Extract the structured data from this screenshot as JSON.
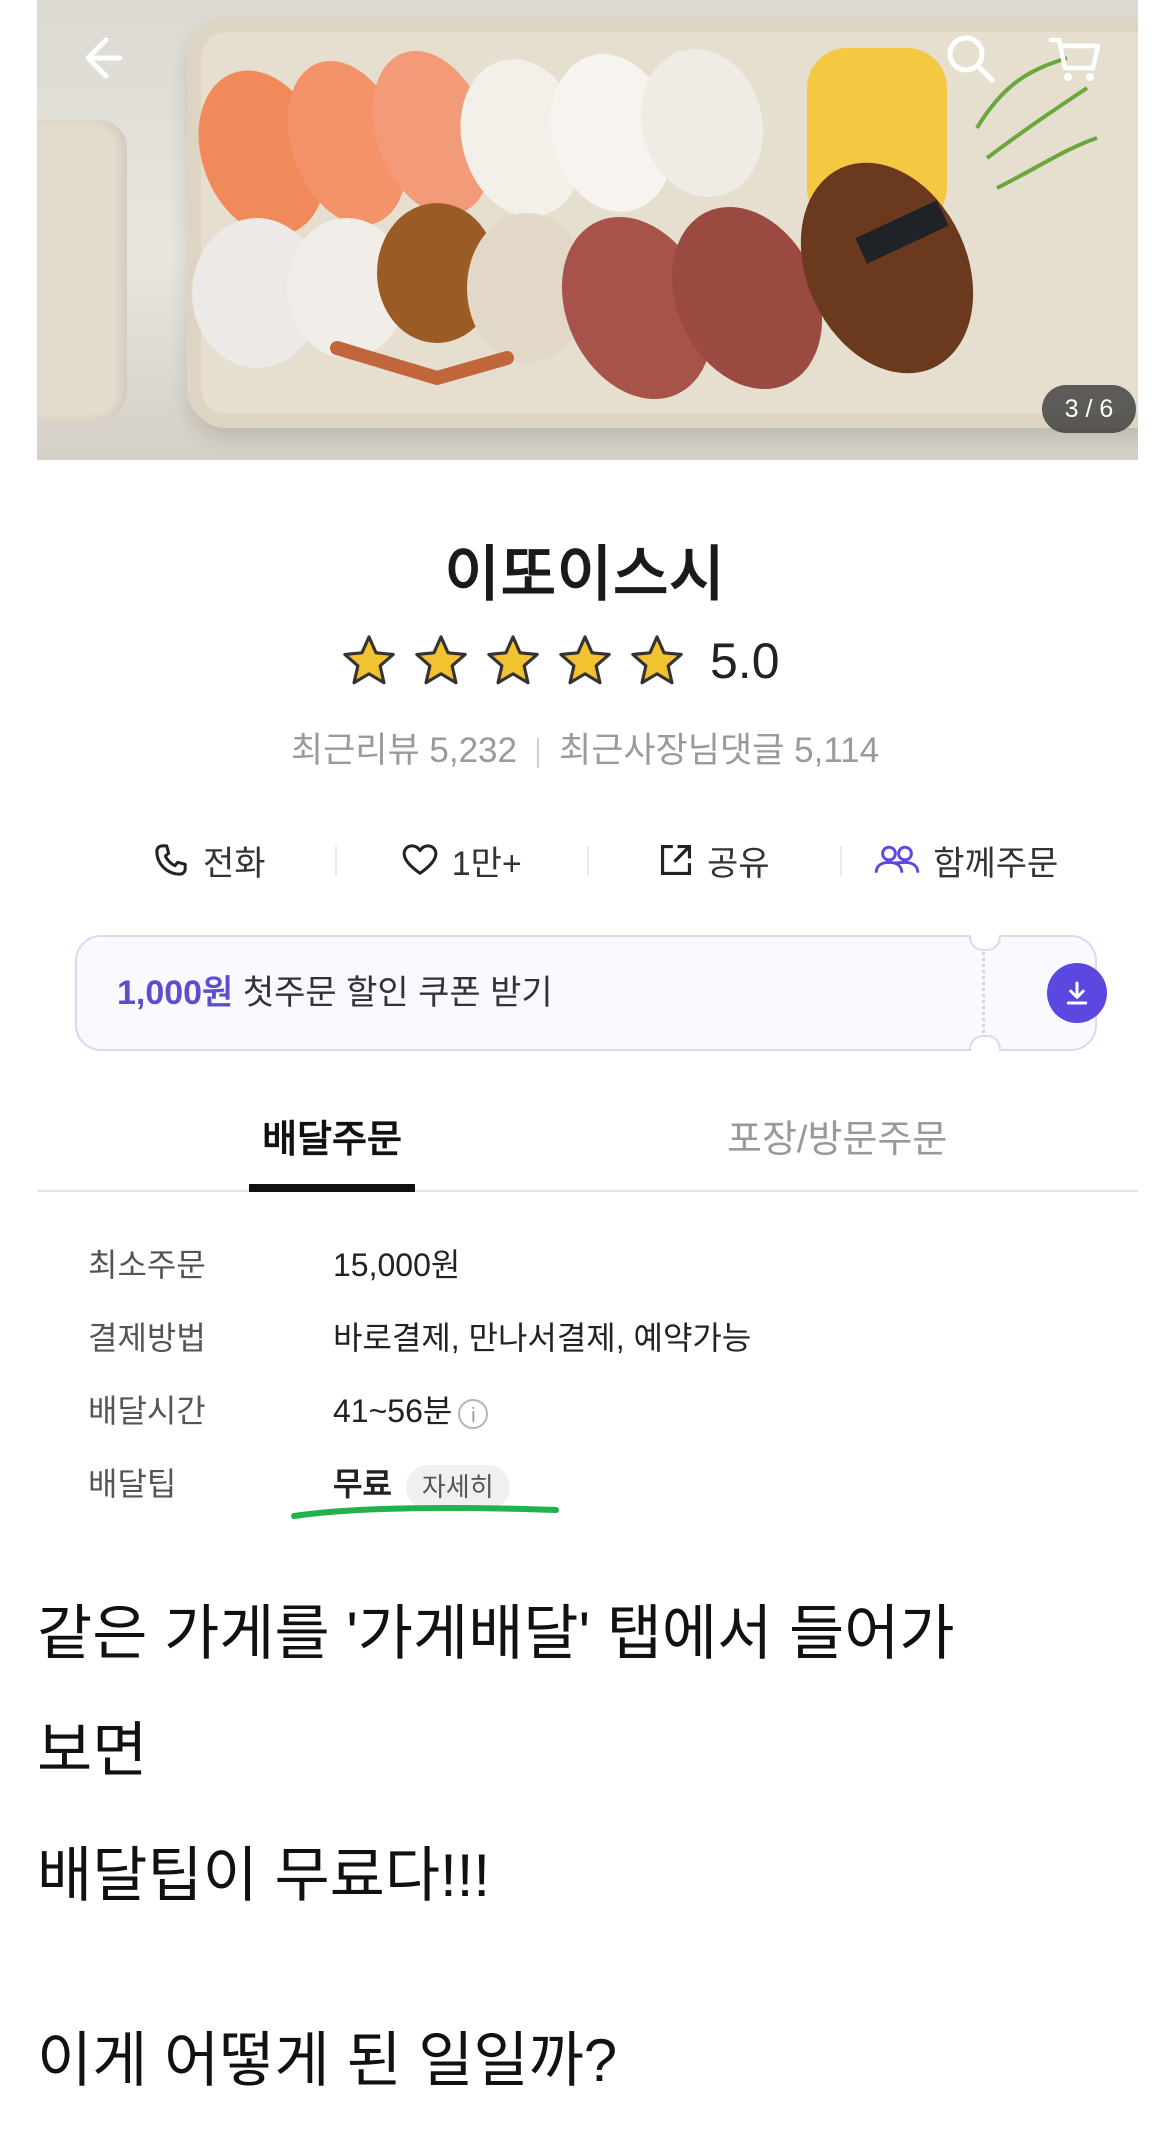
{
  "hero": {
    "page_counter": "3 / 6",
    "icons": [
      "arrow-left-icon",
      "search-icon",
      "cart-icon"
    ]
  },
  "store": {
    "name": "이또이스시",
    "stars": 5,
    "rating": "5.0",
    "recent_reviews": "최근리뷰 5,232",
    "owner_replies": "최근사장님댓글 5,114"
  },
  "actions": {
    "call": "전화",
    "like": "1만+",
    "share": "공유",
    "group_order": "함께주문"
  },
  "coupon": {
    "amount": "1,000원",
    "text": "첫주문 할인 쿠폰 받기"
  },
  "tabs": {
    "delivery": "배달주문",
    "pickup": "포장/방문주문"
  },
  "info": {
    "min_order_label": "최소주문",
    "min_order_value": "15,000원",
    "payment_label": "결제방법",
    "payment_value": "바로결제, 만나서결제, 예약가능",
    "time_label": "배달시간",
    "time_value": "41~56분",
    "tip_label": "배달팁",
    "tip_value": "무료",
    "tip_detail": "자세히"
  },
  "caption": {
    "line1": "같은 가게를 '가게배달' 탭에서 들어가",
    "line2": "보면",
    "line3": "배달팁이 무료다!!!",
    "line4": "이게 어떻게 된 일일까?"
  },
  "colors": {
    "accent": "#5a48e0",
    "highlight": "#22b24c",
    "star": "#f2c230"
  }
}
